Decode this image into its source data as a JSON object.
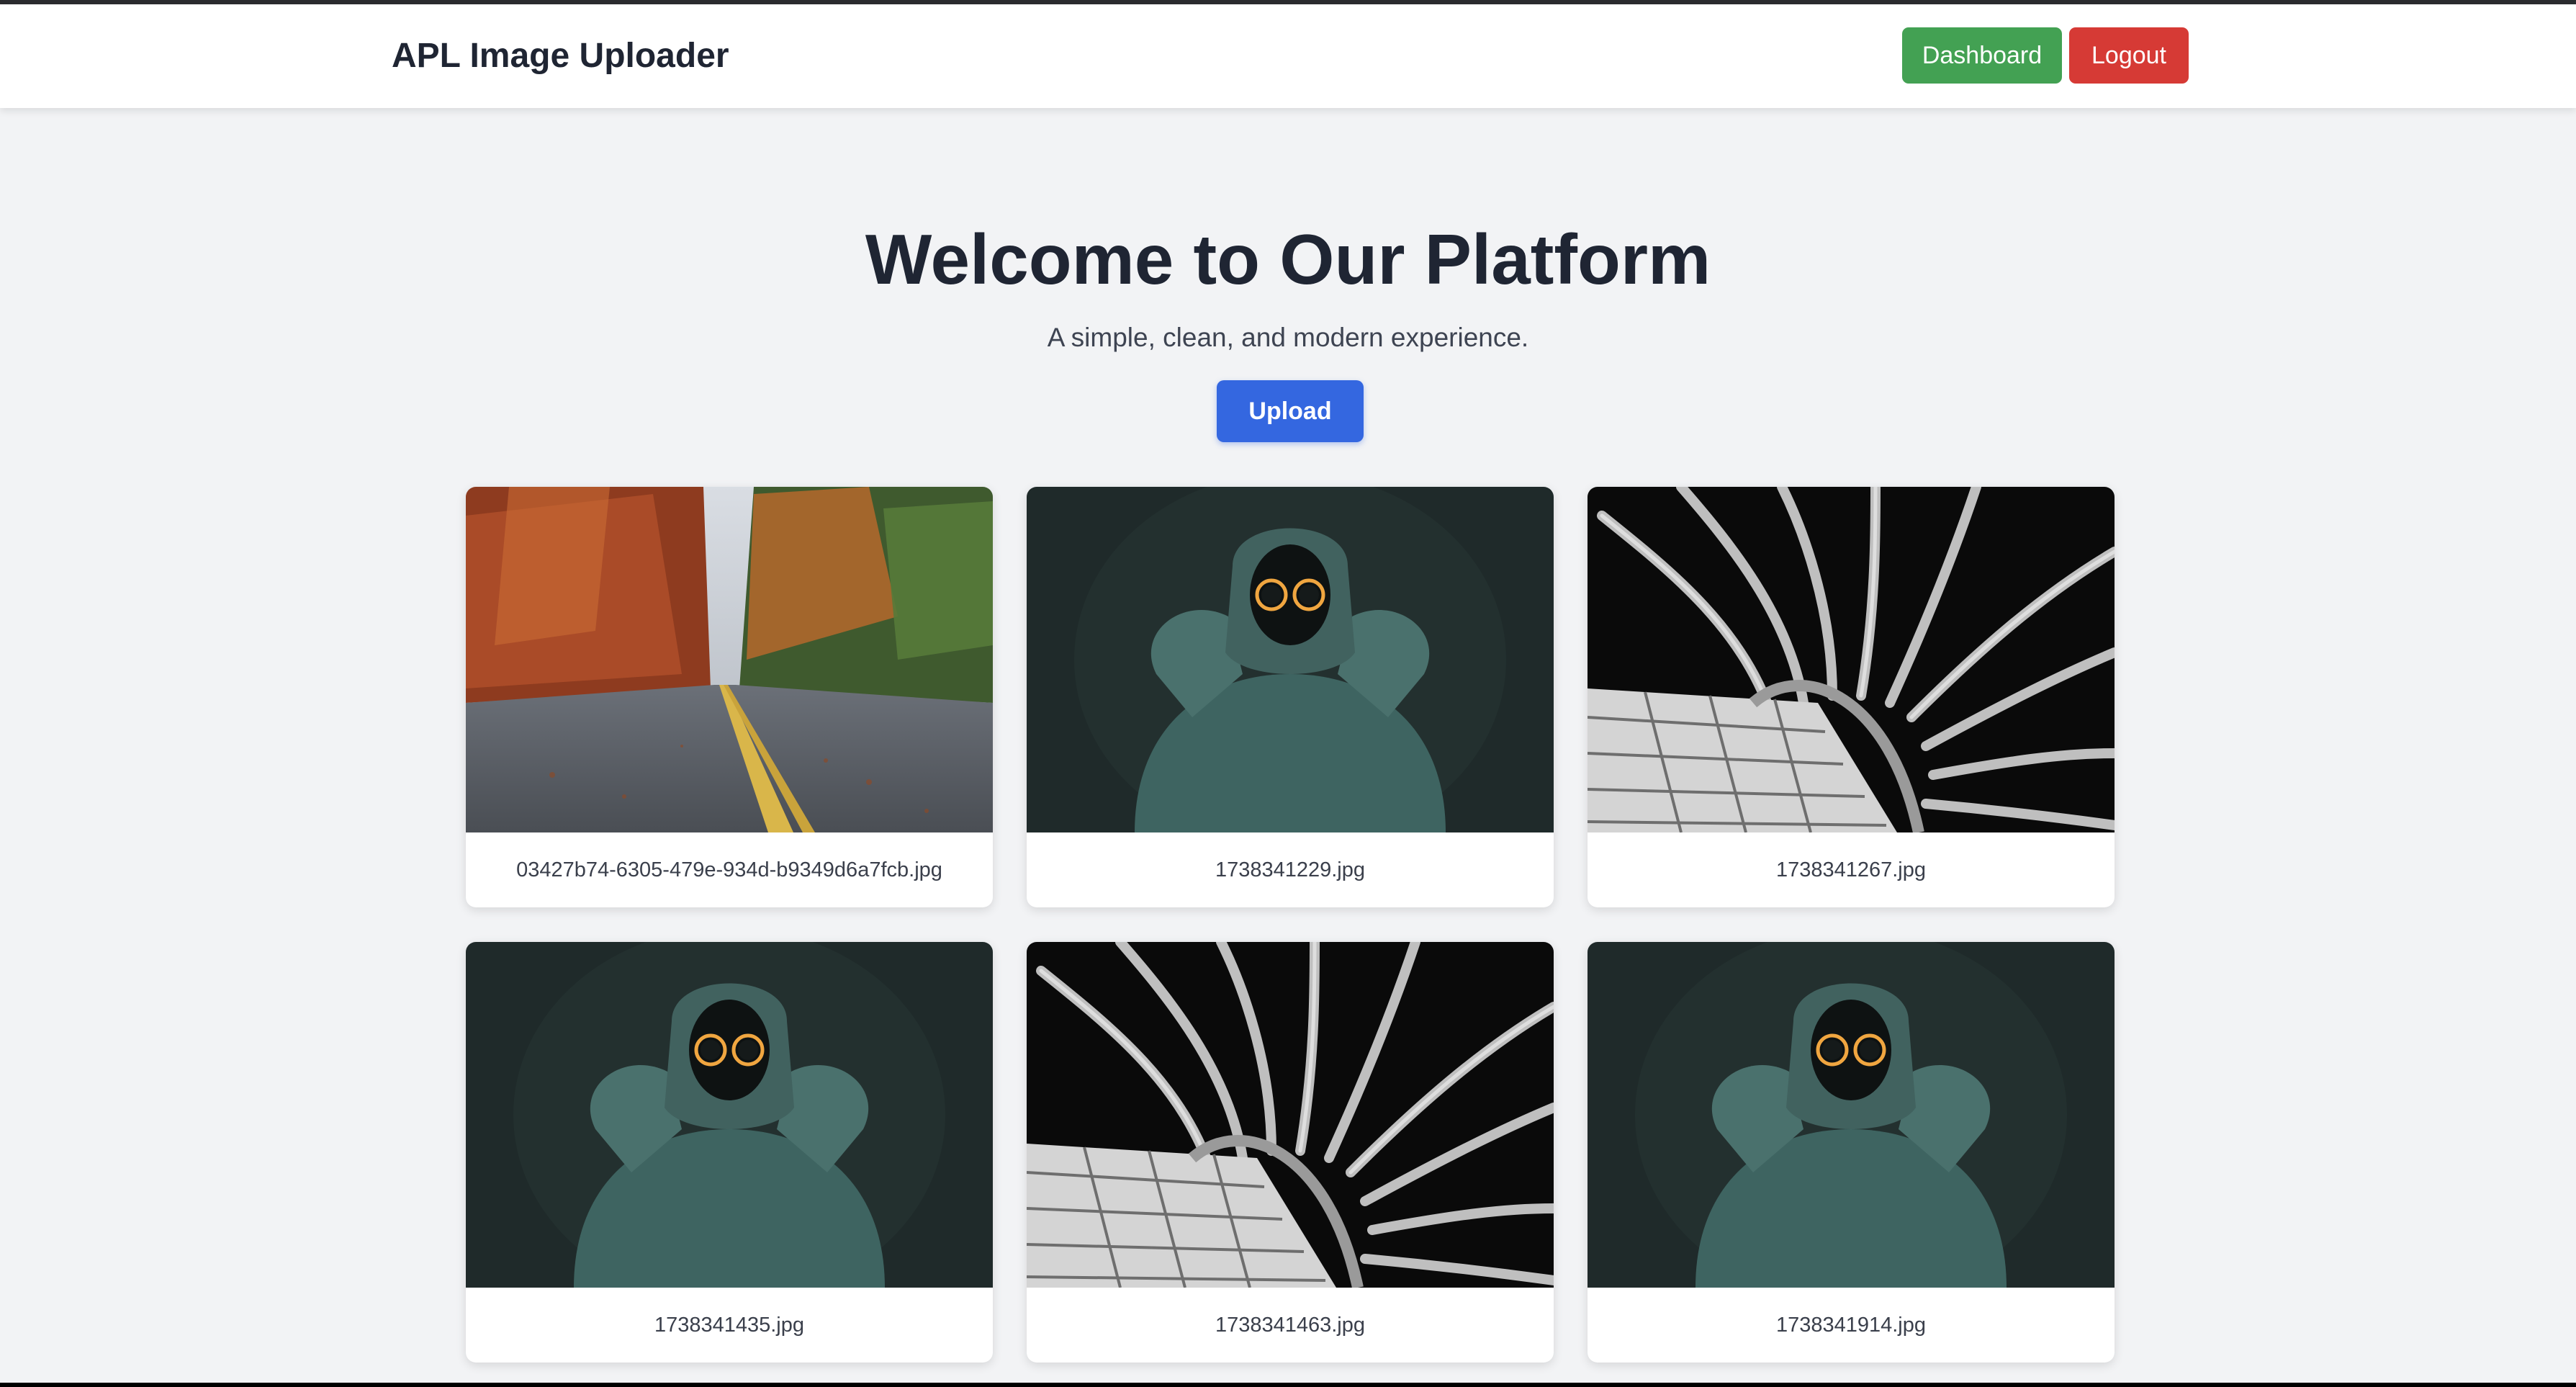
{
  "header": {
    "brand": "APL Image Uploader",
    "dashboard_label": "Dashboard",
    "logout_label": "Logout"
  },
  "hero": {
    "title": "Welcome to Our Platform",
    "subtitle": "A simple, clean, and modern experience.",
    "upload_label": "Upload"
  },
  "gallery": [
    {
      "filename": "03427b74-6305-479e-934d-b9349d6a7fcb.jpg",
      "image": "autumn-road-photo"
    },
    {
      "filename": "1738341229.jpg",
      "image": "hooded-figure-photo"
    },
    {
      "filename": "1738341267.jpg",
      "image": "metal-tubes-photo"
    },
    {
      "filename": "1738341435.jpg",
      "image": "hooded-figure-photo"
    },
    {
      "filename": "1738341463.jpg",
      "image": "metal-tubes-photo"
    },
    {
      "filename": "1738341914.jpg",
      "image": "hooded-figure-photo"
    }
  ],
  "colors": {
    "dashboard_button": "#43a153",
    "logout_button": "#d63a35",
    "upload_button": "#3467e0",
    "page_background": "#f2f3f5"
  }
}
